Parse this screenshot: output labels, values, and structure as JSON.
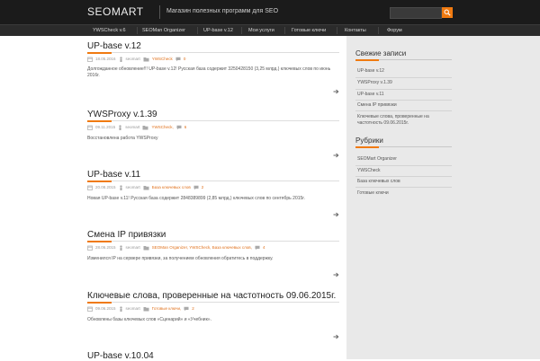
{
  "header": {
    "logo": "SEOMART",
    "tagline": "Магазин полезных программ для SEO"
  },
  "nav": {
    "items": [
      {
        "label": "YWSCheck v.6"
      },
      {
        "label": "SEOMan Organizer"
      },
      {
        "label": "UP-base v.12"
      },
      {
        "label": "Мои услуги"
      },
      {
        "label": "Готовые ключи"
      },
      {
        "label": "Контакты"
      },
      {
        "label": "Форум"
      }
    ]
  },
  "posts": [
    {
      "title": "UP-base v.12",
      "date": "18.05.2016",
      "author": "seomart",
      "categories": "YWSCheck",
      "comments": "0",
      "excerpt": "Долгожданное обновление!!! UP-base v.12! Русская база содержит 3250428150 (3,25 млрд.) ключевых слов по июнь 2016г."
    },
    {
      "title": "YWSProxy v.1.39",
      "date": "09.11.2015",
      "author": "seomart",
      "categories": "YWSCheck,",
      "comments": "6",
      "excerpt": "Восстановлена работа YWSProxy"
    },
    {
      "title": "UP-base v.11",
      "date": "20.08.2015",
      "author": "seomart",
      "categories": "База ключевых слов",
      "comments": "2",
      "excerpt": "Новая UP-base v.11! Русская база содержит 2848389899 (2,85 млрд.) ключевых слов по сентябрь 2015г."
    },
    {
      "title": "Смена IP привязки",
      "date": "28.06.2015",
      "author": "seomart",
      "categories": "SEOMan Organizer, YWSCheck, База ключевых слов,",
      "comments": "4",
      "excerpt": "Изменился IP на сервере привязки, за получением обновления обратитесь в поддержку."
    },
    {
      "title": "Ключевые слова, проверенные на частотность 09.06.2015г.",
      "date": "09.06.2015",
      "author": "seomart",
      "categories": "Готовые ключи,",
      "comments": "2",
      "excerpt": "Обновлены базы ключевых слов «Сценарий» и «Учебник»."
    },
    {
      "title": "UP-base v.10.04"
    }
  ],
  "sidebar": {
    "recent_title": "Свежие записи",
    "recent": [
      {
        "label": "UP-base v.12"
      },
      {
        "label": "YWSProxy v.1.39"
      },
      {
        "label": "UP-base v.11"
      },
      {
        "label": "Смена IP привязки"
      },
      {
        "label": "Ключевые слова, проверенные на частотность 09.06.2015г."
      }
    ],
    "cats_title": "Рубрики",
    "cats": [
      {
        "label": "SEOMart Organizer"
      },
      {
        "label": "YWSCheck"
      },
      {
        "label": "База ключевых слов"
      },
      {
        "label": "Готовые ключи"
      }
    ]
  },
  "colors": {
    "accent": "#f07a10",
    "header_bg": "#1b1b1b",
    "sidebar_bg": "#e9e9e9"
  }
}
